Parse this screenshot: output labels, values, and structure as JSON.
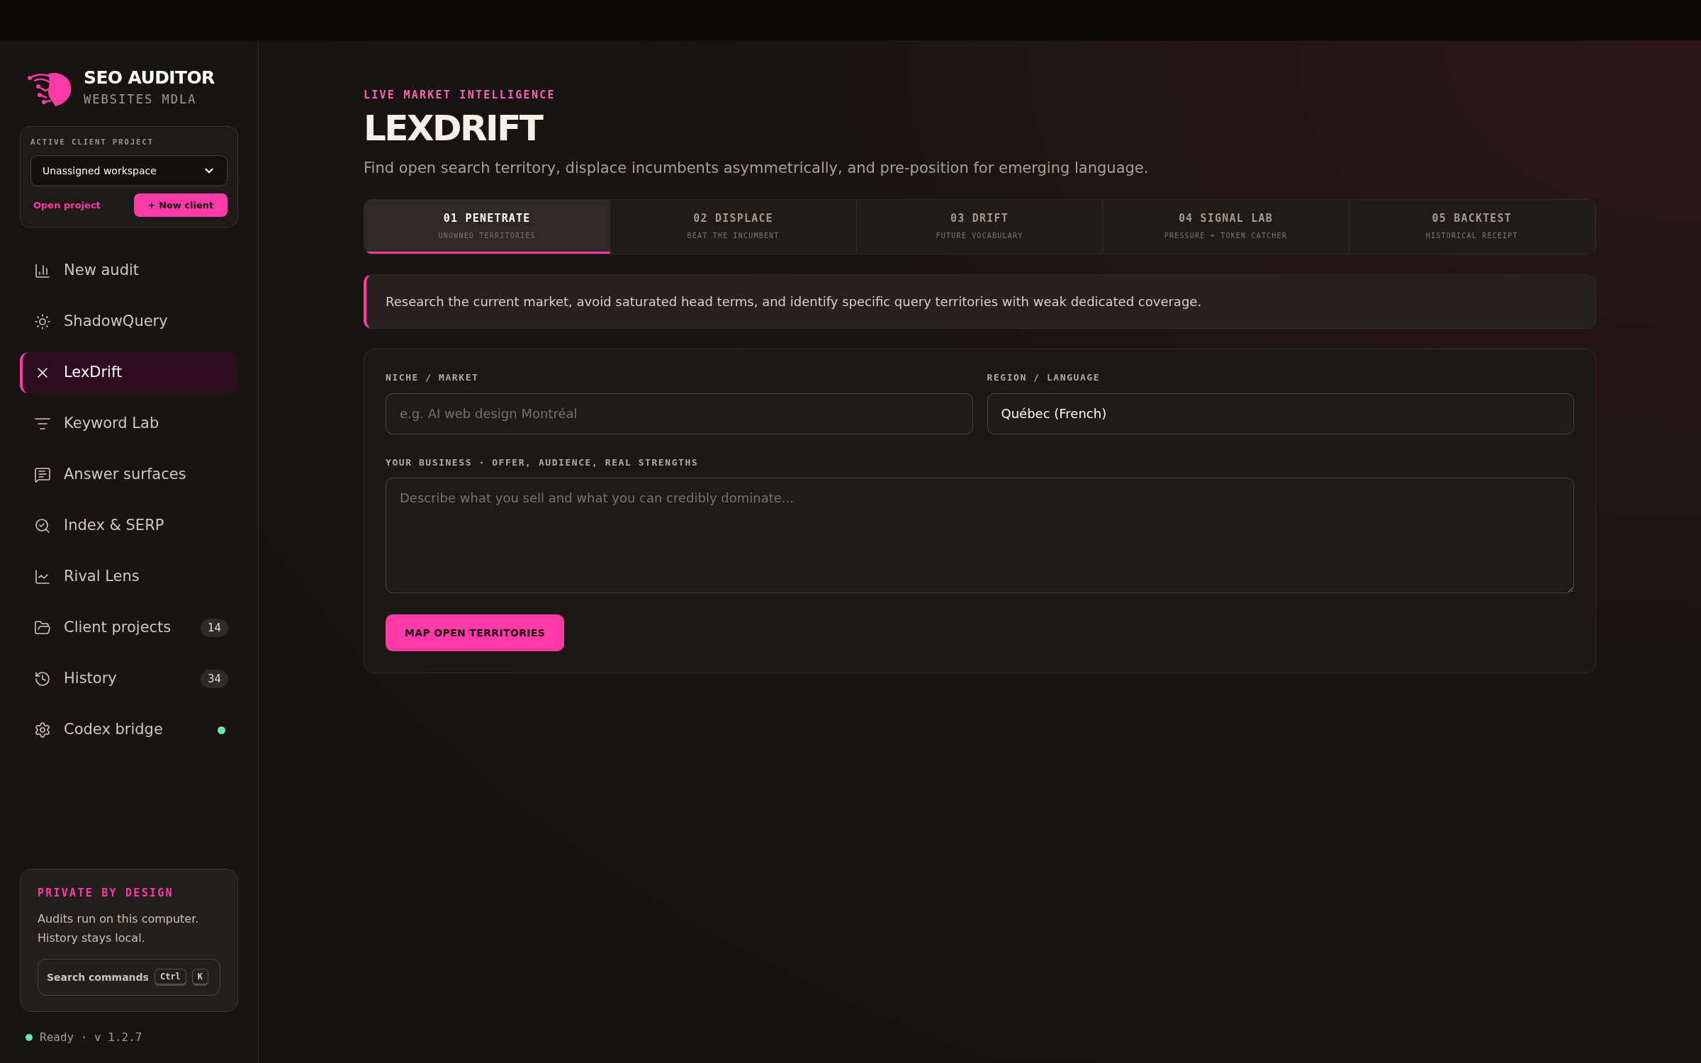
{
  "brand": {
    "title": "SEO AUDITOR",
    "subtitle": "WEBSITES MDLA"
  },
  "project_card": {
    "label": "ACTIVE CLIENT PROJECT",
    "select_value": "Unassigned workspace",
    "link": "Open project",
    "button": "+ New client"
  },
  "nav": [
    {
      "label": "New audit",
      "selected": false
    },
    {
      "label": "ShadowQuery",
      "selected": false
    },
    {
      "label": "LexDrift",
      "selected": true
    },
    {
      "label": "Keyword Lab",
      "selected": false
    },
    {
      "label": "Answer surfaces",
      "selected": false
    },
    {
      "label": "Index & SERP",
      "selected": false
    },
    {
      "label": "Rival Lens",
      "selected": false
    },
    {
      "label": "Client projects",
      "selected": false,
      "badge": "14"
    },
    {
      "label": "History",
      "selected": false,
      "badge": "34"
    },
    {
      "label": "Codex bridge",
      "selected": false,
      "online": true
    }
  ],
  "privacy_card": {
    "title": "PRIVATE BY DESIGN",
    "text": "Audits run on this computer. History stays local.",
    "search_label": "Search commands",
    "keys": [
      "Ctrl",
      "K"
    ]
  },
  "status": {
    "online": true,
    "text": "Ready · v 1.2.7"
  },
  "header": {
    "eyebrow": "LIVE MARKET INTELLIGENCE",
    "title": "LEXDRIFT",
    "subtitle": "Find open search territory, displace incumbents asymmetrically, and pre-position for emerging language."
  },
  "tabs": [
    {
      "label": "01 PENETRATE",
      "caption": "UNOWNED TERRITORIES",
      "selected": true
    },
    {
      "label": "02 DISPLACE",
      "caption": "BEAT THE INCUMBENT",
      "selected": false
    },
    {
      "label": "03 DRIFT",
      "caption": "FUTURE VOCABULARY",
      "selected": false
    },
    {
      "label": "04 SIGNAL LAB",
      "caption": "PRESSURE + TOKEN CATCHER",
      "selected": false
    },
    {
      "label": "05 BACKTEST",
      "caption": "HISTORICAL RECEIPT",
      "selected": false
    }
  ],
  "notice": "Research the current market, avoid saturated head terms, and identify specific query territories with weak dedicated coverage.",
  "form": {
    "niche": {
      "label": "NICHE / MARKET",
      "placeholder": "e.g. AI web design Montréal"
    },
    "region": {
      "label": "REGION / LANGUAGE",
      "value": "Québec (French)"
    },
    "business": {
      "label": "YOUR BUSINESS · OFFER, AUDIENCE, REAL STRENGTHS",
      "placeholder": "Describe what you sell and what you can credibly dominate..."
    },
    "submit": "MAP OPEN TERRITORIES"
  }
}
